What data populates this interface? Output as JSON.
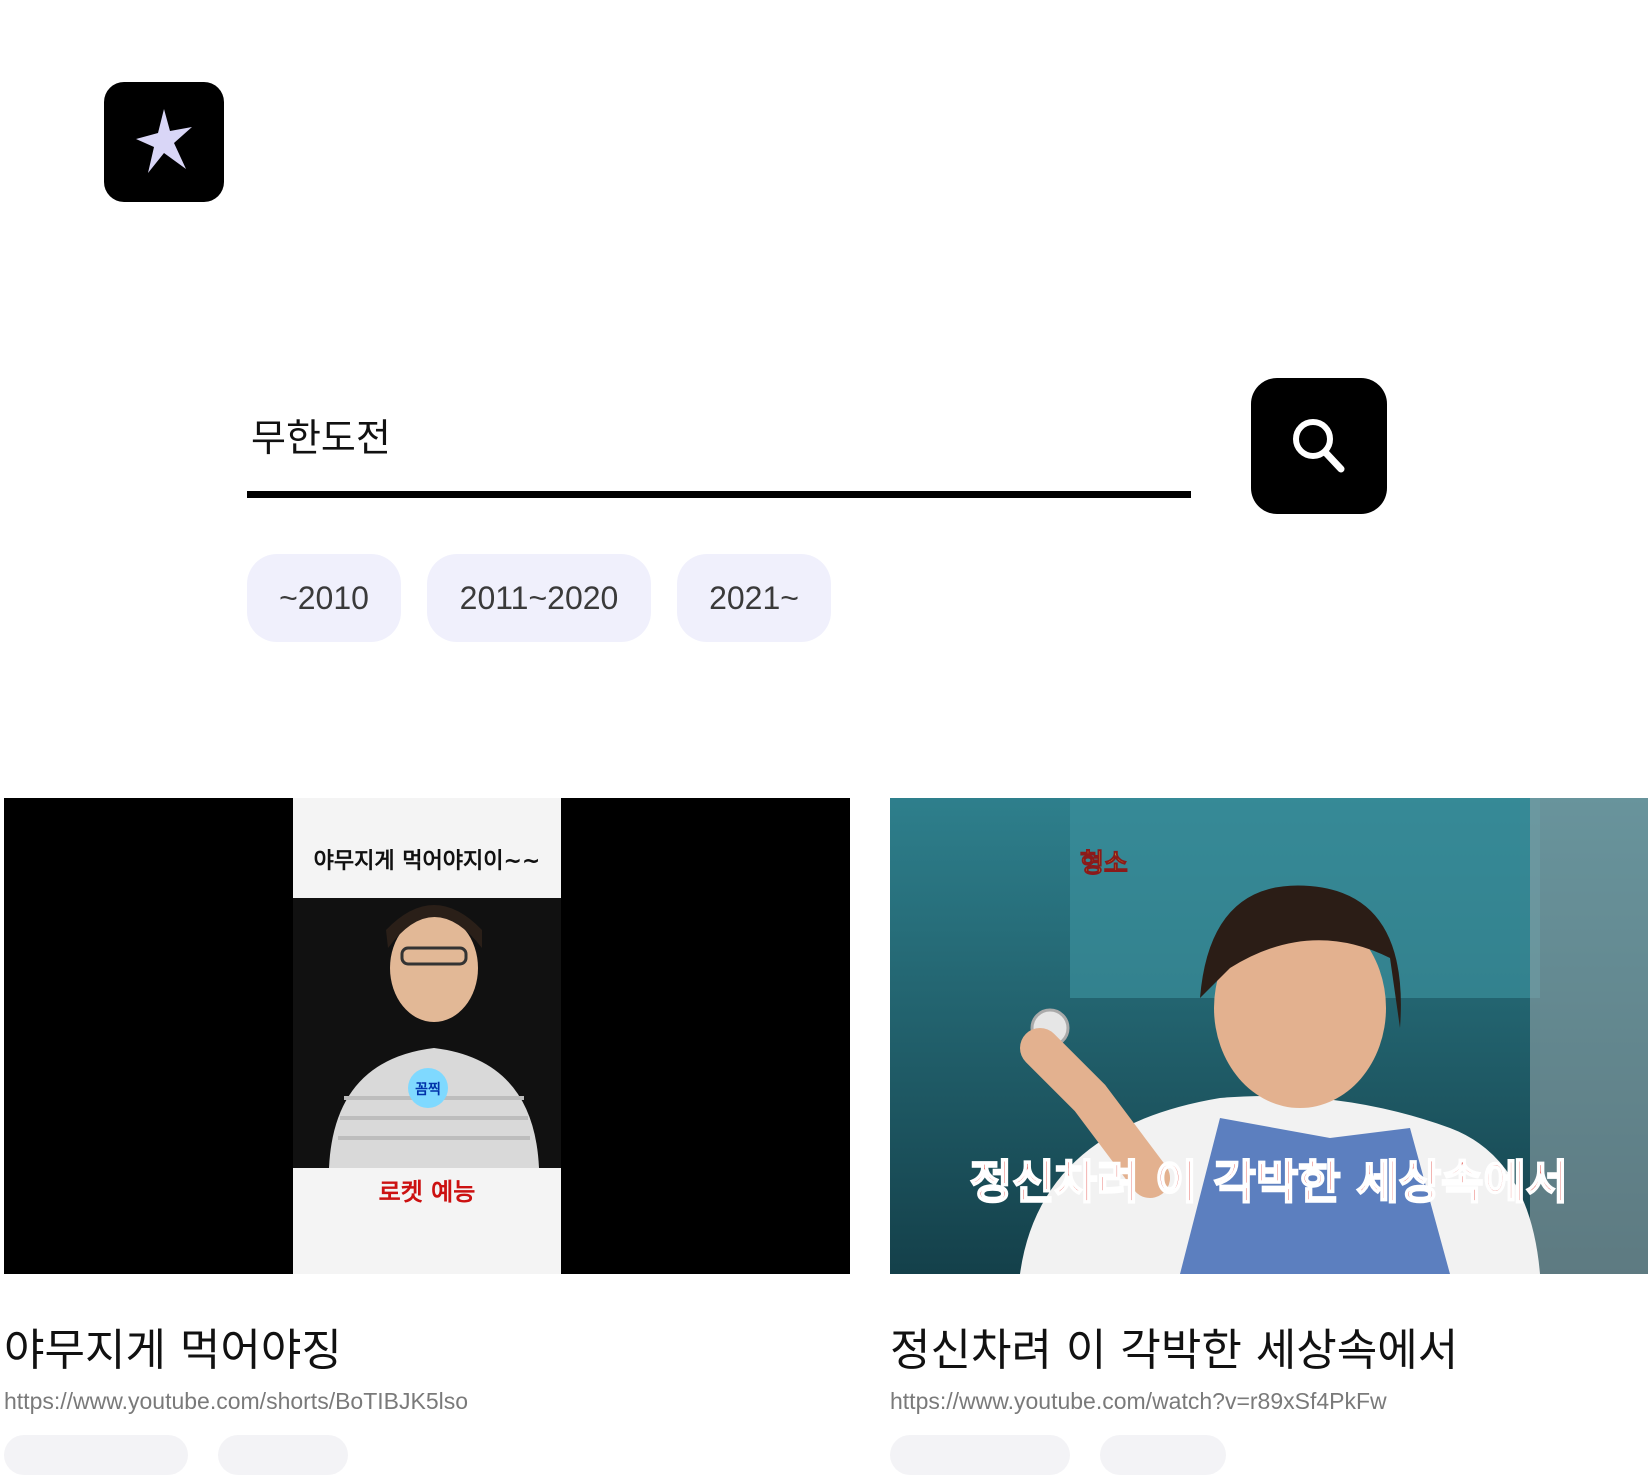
{
  "logo": {
    "icon": "sparkle-icon"
  },
  "search": {
    "value": "무한도전",
    "button_icon": "search-icon"
  },
  "filters": [
    {
      "label": "~2010"
    },
    {
      "label": "2011~2020"
    },
    {
      "label": "2021~"
    }
  ],
  "results": [
    {
      "title": "야무지게 먹어야징",
      "url": "https://www.youtube.com/shorts/BoTIBJK5lso",
      "thumbnail": {
        "caption_top": "야무지게 먹어야지이~~",
        "caption_bottom": "로켓 예능",
        "badge": "꼼찍"
      }
    },
    {
      "title": "정신차려 이 각박한 세상속에서",
      "url": "https://www.youtube.com/watch?v=r89xSf4PkFw",
      "thumbnail": {
        "caption_bottom": "정신차려 이 각박한 세상속에서",
        "logo_text": "형소"
      }
    }
  ],
  "colors": {
    "accent": "#000000",
    "chip_bg": "#f0f0fc",
    "logo_star": "#d9d6f7"
  }
}
